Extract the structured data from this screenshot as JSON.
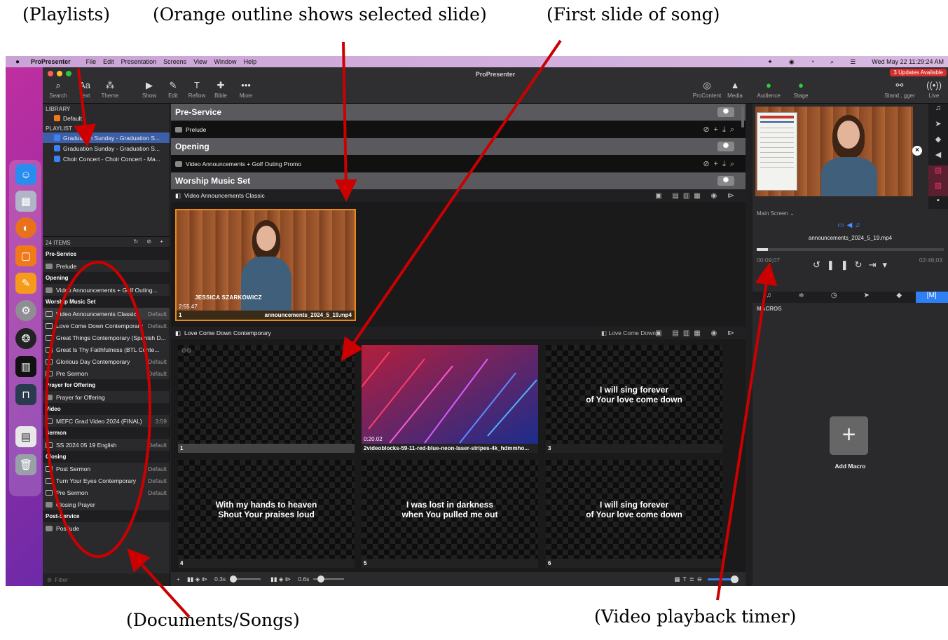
{
  "annotations": {
    "playlists": "(Playlists)",
    "selected": "(Orange outline shows selected slide)",
    "first_slide": "(First slide of song)",
    "documents": "(Documents/Songs)",
    "timer": "(Video playback timer)"
  },
  "menubar": {
    "app": "ProPresenter",
    "items": [
      "File",
      "Edit",
      "Presentation",
      "Screens",
      "View",
      "Window",
      "Help"
    ],
    "clock": "Wed May 22  11:29:24 AM"
  },
  "window": {
    "title": "ProPresenter",
    "updates": "3 Updates Available",
    "toolbar": [
      "Search",
      "Text",
      "Theme",
      "Show",
      "Edit",
      "Reflow",
      "Bible",
      "More"
    ],
    "right_toolbar": [
      "ProContent",
      "Media",
      "Audience",
      "Stage",
      "Stand...gger",
      "Live"
    ]
  },
  "library": {
    "library_label": "LIBRARY",
    "library_item": "Default",
    "playlist_label": "PLAYLIST",
    "playlists": [
      "Graduation Sunday - Graduation S...",
      "Graduation Sunday - Graduation S...",
      "Choir Concert - Choir Concert - Ma..."
    ]
  },
  "items": {
    "count": "24 ITEMS",
    "filter_placeholder": "Filter",
    "list": [
      {
        "type": "group",
        "label": "Pre-Service"
      },
      {
        "type": "doc",
        "label": "Prelude",
        "detail": ""
      },
      {
        "type": "group",
        "label": "Opening"
      },
      {
        "type": "doc",
        "label": "Video Announcements + Golf Outing...",
        "detail": ""
      },
      {
        "type": "group",
        "label": "Worship Music Set"
      },
      {
        "type": "pres",
        "label": "Video Announcements Classic",
        "detail": "Default"
      },
      {
        "type": "pres",
        "label": "Love Come Down Contemporary",
        "detail": "Default"
      },
      {
        "type": "pres",
        "label": "Great Things Contemporary (Spanish D...",
        "detail": ""
      },
      {
        "type": "pres",
        "label": "Great Is Thy Faithfulness (BTL Conte...",
        "detail": ""
      },
      {
        "type": "pres",
        "label": "Glorious Day Contemporary",
        "detail": "Default"
      },
      {
        "type": "pres",
        "label": "Pre Sermon",
        "detail": "Default"
      },
      {
        "type": "group",
        "label": "Prayer for Offering"
      },
      {
        "type": "doc",
        "label": "Prayer for Offering",
        "detail": ""
      },
      {
        "type": "group",
        "label": "Video"
      },
      {
        "type": "media",
        "label": "MEFC Grad Video 2024 (FINAL)",
        "detail": "3:59"
      },
      {
        "type": "group",
        "label": "Sermon"
      },
      {
        "type": "pres",
        "label": "SS 2024 05 19 English",
        "detail": "Default"
      },
      {
        "type": "group",
        "label": "Closing"
      },
      {
        "type": "pres",
        "label": "Post Sermon",
        "detail": "Default"
      },
      {
        "type": "pres",
        "label": "Turn Your Eyes Contemporary",
        "detail": "Default"
      },
      {
        "type": "pres",
        "label": "Pre Sermon",
        "detail": "Default"
      },
      {
        "type": "doc",
        "label": "Closing Prayer",
        "detail": ""
      },
      {
        "type": "group",
        "label": "Post-Service"
      },
      {
        "type": "doc",
        "label": "Postlude",
        "detail": ""
      }
    ]
  },
  "center": {
    "groups": {
      "preservice": "Pre-Service",
      "opening": "Opening",
      "worship": "Worship Music Set"
    },
    "rows": {
      "prelude": "Prelude",
      "video_ann": "Video Announcements + Golf Outing Promo"
    },
    "sec1_title": "Video Announcements Classic",
    "sec2_title": "Love Come Down Contemporary",
    "sec2_arrangement": "Love Come Down",
    "slide_video": {
      "num": "1",
      "file": "announcements_2024_5_19.mp4",
      "duration": "2:55.47",
      "lower_third": "JESSICA SZARKOWICZ"
    },
    "slides": [
      {
        "num": "1",
        "text": ""
      },
      {
        "num": "2",
        "text": "videoblocks-59-11-red-blue-neon-laser-stripes-4k_hdmmho...",
        "time": "0:20.02"
      },
      {
        "num": "3",
        "text": "I will sing forever\nof Your love come down"
      },
      {
        "num": "4",
        "text": "With my hands to heaven\nShout Your praises loud"
      },
      {
        "num": "5",
        "text": "I was lost in darkness\nwhen You pulled me out"
      },
      {
        "num": "6",
        "text": "I will sing forever\nof Your love come down"
      }
    ],
    "bottom": {
      "t1": "0.3s",
      "t2": "0.6s"
    }
  },
  "right": {
    "screen_label": "Main Screen",
    "media_file": "announcements_2024_5_19.mp4",
    "elapsed": "00:09;07",
    "remaining": "02:46;03",
    "macros_label": "MACROS",
    "add_macro": "Add Macro"
  }
}
